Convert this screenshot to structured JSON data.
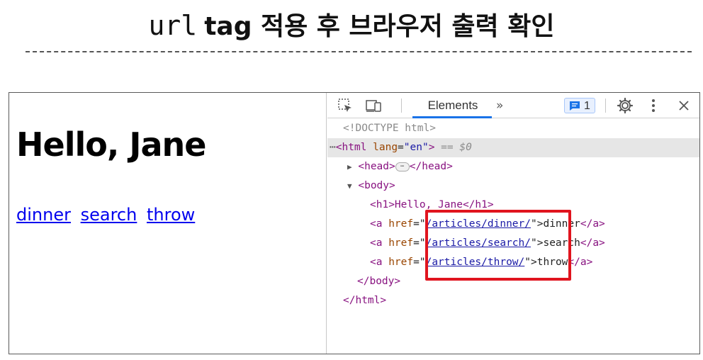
{
  "slide": {
    "title_code": "url",
    "title_text": "tag 적용 후 브라우저 출력 확인"
  },
  "page": {
    "heading": "Hello, Jane",
    "links": [
      {
        "label": "dinner"
      },
      {
        "label": "search"
      },
      {
        "label": "throw"
      }
    ]
  },
  "devtools": {
    "active_tab": "Elements",
    "more_tabs": "»",
    "issues_count": "1",
    "tree": {
      "doctype": "<!DOCTYPE html>",
      "html_open": "<html",
      "lang_attr": "lang",
      "lang_val": "\"en\"",
      "html_open_close": ">",
      "selected_marker": "== $0",
      "head_open": "<head>",
      "head_close": "</head>",
      "body_open": "<body>",
      "h1_line": "<h1>Hello, Jane</h1>",
      "anchors": [
        {
          "href": "/articles/dinner/",
          "text": "dinner"
        },
        {
          "href": "/articles/search/",
          "text": "search"
        },
        {
          "href": "/articles/throw/",
          "text": "throw"
        }
      ],
      "a_open": "<a",
      "href_attr": "href",
      "a_close": "</a>",
      "body_close": "</body>",
      "html_close": "</html>"
    }
  },
  "colors": {
    "highlight": "#e0141e",
    "link": "#0000ee",
    "devtools_accent": "#1a73e8"
  }
}
